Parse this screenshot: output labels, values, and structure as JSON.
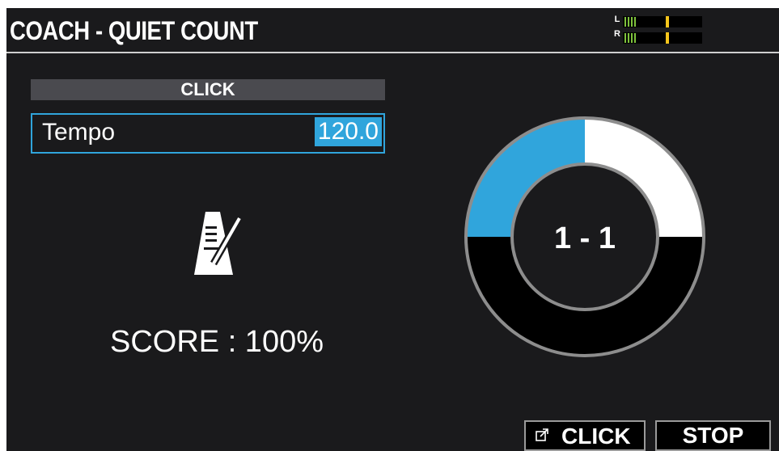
{
  "header": {
    "title": "COACH - QUIET COUNT",
    "meter": {
      "left_label": "L",
      "right_label": "R",
      "left_level": 0.36,
      "right_level": 0.36,
      "peak_level": 0.82,
      "level_color": "#7ec23c",
      "peak_color": "#f6c51c"
    }
  },
  "panel": {
    "section_label": "CLICK",
    "tempo_label": "Tempo",
    "tempo_value": "120.0",
    "metronome_icon": "metronome-icon",
    "score_text": "SCORE : 100%"
  },
  "count": {
    "text": "1 - 1",
    "measures_total": 4,
    "current_measure": 1,
    "colors": {
      "current": "#30a5dc",
      "upcoming": "#ffffff",
      "quiet": "#000000"
    }
  },
  "function_buttons": {
    "click": {
      "label": "CLICK",
      "icon": "external-link-icon"
    },
    "stop": {
      "label": "STOP"
    }
  },
  "colors": {
    "accent": "#30a5dc",
    "background": "#1a1a1c"
  }
}
